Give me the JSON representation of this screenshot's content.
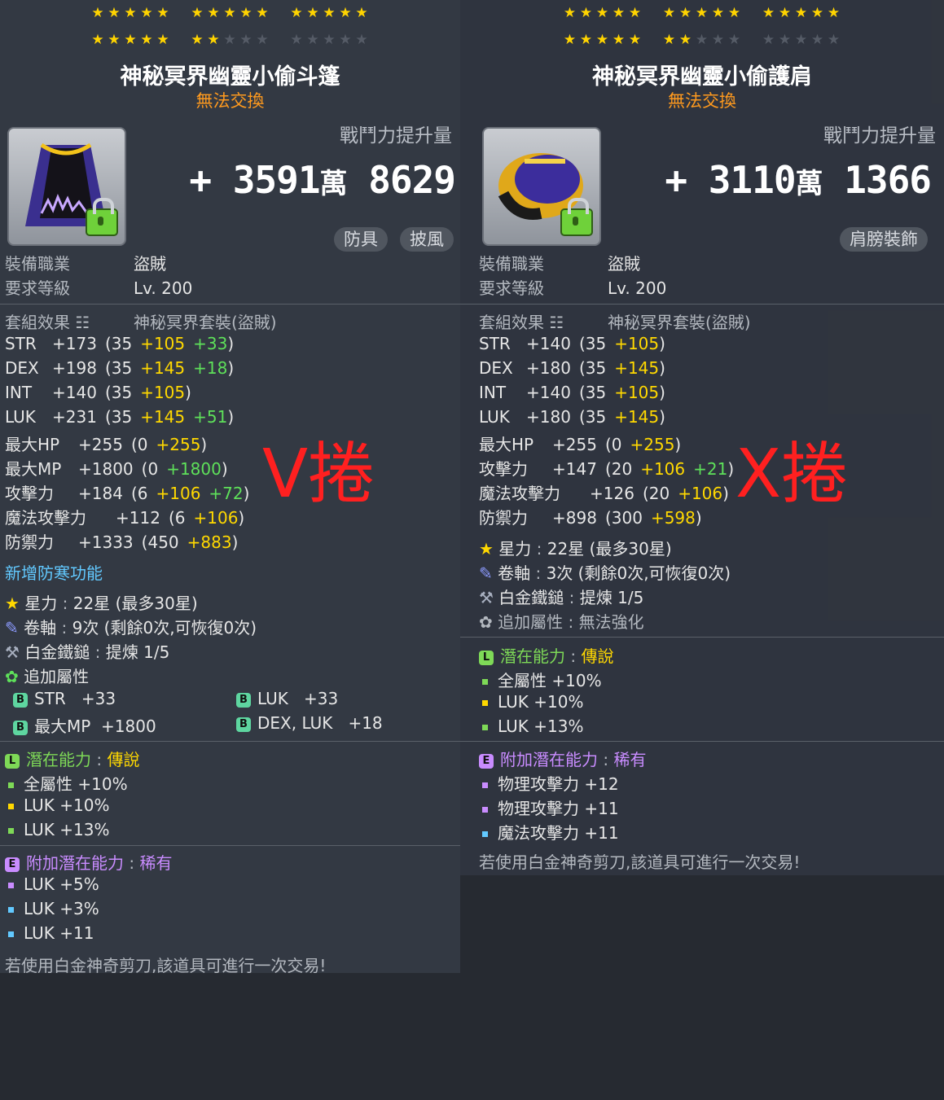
{
  "left": {
    "stars_on": 22,
    "stars_total": 30,
    "name": "神秘冥界幽靈小偷斗篷",
    "trade": "無法交換",
    "power_label": "戰鬥力提升量",
    "power_plus": "+",
    "power_main": "3591",
    "power_unit": "萬",
    "power_rest": "8629",
    "tags": [
      "防具",
      "披風"
    ],
    "job_label": "裝備職業",
    "job_value": "盜賊",
    "level_label": "要求等級",
    "level_value": "Lv. 200",
    "set_label": "套組效果",
    "set_value": "神秘冥界套裝(盜賊)",
    "stats": [
      {
        "name": "STR",
        "total": "+173",
        "base": "35",
        "flame": "+105",
        "enh": "+33"
      },
      {
        "name": "DEX",
        "total": "+198",
        "base": "35",
        "flame": "+145",
        "enh": "+18"
      },
      {
        "name": "INT",
        "total": "+140",
        "base": "35",
        "flame": "+105",
        "enh": ""
      },
      {
        "name": "LUK",
        "total": "+231",
        "base": "35",
        "flame": "+145",
        "enh": "+51"
      },
      {
        "name": "最大HP",
        "total": "+255",
        "base": "0",
        "flame": "+255",
        "enh": ""
      },
      {
        "name": "最大MP",
        "total": "+1800",
        "base": "0",
        "flame": "+1800",
        "enh": "",
        "cyan": true
      },
      {
        "name": "攻擊力",
        "total": "+184",
        "base": "6",
        "flame": "+106",
        "enh": "+72"
      },
      {
        "name": "魔法攻擊力",
        "total": "+112",
        "base": "6",
        "flame": "+106",
        "enh": ""
      },
      {
        "name": "防禦力",
        "total": "+1333",
        "base": "450",
        "flame": "+883",
        "enh": ""
      }
    ],
    "new_feature": "新增防寒功能",
    "starforce_label": "星力",
    "starforce_value": "22星 (最多30星)",
    "scroll_label": "卷軸",
    "scroll_value": "9次 (剩餘0次,可恢復0次)",
    "hammer_label": "白金鐵鎚",
    "hammer_value": "提煉 1/5",
    "bonus_label": "追加屬性",
    "bonus": [
      {
        "name": "STR",
        "value": "+33"
      },
      {
        "name": "LUK",
        "value": "+33"
      },
      {
        "name": "最大MP",
        "value": "+1800"
      },
      {
        "name": "DEX, LUK",
        "value": "+18"
      }
    ],
    "potential_label": "潛在能力",
    "potential_grade": "傳說",
    "potential": [
      "全屬性 +10%",
      "LUK +10%",
      "LUK +13%"
    ],
    "add_potential_label": "附加潛在能力",
    "add_potential_grade": "稀有",
    "add_potential": [
      "LUK +5%",
      "LUK +3%",
      "LUK +11"
    ],
    "footer": "若使用白金神奇剪刀,該道具可進行一次交易!",
    "overlay": "V捲"
  },
  "right": {
    "stars_on": 22,
    "stars_total": 30,
    "name": "神秘冥界幽靈小偷護肩",
    "trade": "無法交換",
    "power_label": "戰鬥力提升量",
    "power_plus": "+",
    "power_main": "3110",
    "power_unit": "萬",
    "power_rest": "1366",
    "tags": [
      "肩膀裝飾"
    ],
    "job_label": "裝備職業",
    "job_value": "盜賊",
    "level_label": "要求等級",
    "level_value": "Lv. 200",
    "set_label": "套組效果",
    "set_value": "神秘冥界套裝(盜賊)",
    "stats": [
      {
        "name": "STR",
        "total": "+140",
        "base": "35",
        "flame": "+105",
        "enh": ""
      },
      {
        "name": "DEX",
        "total": "+180",
        "base": "35",
        "flame": "+145",
        "enh": ""
      },
      {
        "name": "INT",
        "total": "+140",
        "base": "35",
        "flame": "+105",
        "enh": ""
      },
      {
        "name": "LUK",
        "total": "+180",
        "base": "35",
        "flame": "+145",
        "enh": ""
      },
      {
        "name": "最大HP",
        "total": "+255",
        "base": "0",
        "flame": "+255",
        "enh": ""
      },
      {
        "name": "攻擊力",
        "total": "+147",
        "base": "20",
        "flame": "+106",
        "enh": "+21"
      },
      {
        "name": "魔法攻擊力",
        "total": "+126",
        "base": "20",
        "flame": "+106",
        "enh": ""
      },
      {
        "name": "防禦力",
        "total": "+898",
        "base": "300",
        "flame": "+598",
        "enh": ""
      }
    ],
    "starforce_label": "星力",
    "starforce_value": "22星 (最多30星)",
    "scroll_label": "卷軸",
    "scroll_value": "3次 (剩餘0次,可恢復0次)",
    "hammer_label": "白金鐵鎚",
    "hammer_value": "提煉 1/5",
    "bonus_label": "追加屬性",
    "bonus_value": "無法強化",
    "potential_label": "潛在能力",
    "potential_grade": "傳說",
    "potential": [
      "全屬性 +10%",
      "LUK +10%",
      "LUK +13%"
    ],
    "add_potential_label": "附加潛在能力",
    "add_potential_grade": "稀有",
    "add_potential": [
      "物理攻擊力 +12",
      "物理攻擊力 +11",
      "魔法攻擊力 +11"
    ],
    "footer": "若使用白金神奇剪刀,該道具可進行一次交易!",
    "overlay": "X捲"
  },
  "colors": {
    "star_on": "#ffd400",
    "trade": "#ff9a1e",
    "flame": "#ffd800",
    "enhance": "#5ee05a",
    "legendary": "#7ed957",
    "rare": "#c98cff",
    "overlay": "#ff2020"
  }
}
